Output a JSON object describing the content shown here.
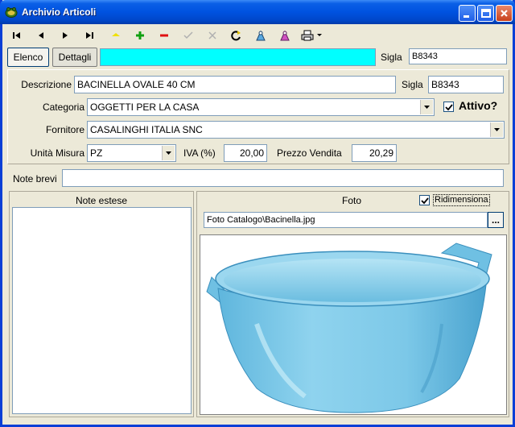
{
  "window": {
    "title": "Archivio Articoli",
    "icon": "frog-app-icon"
  },
  "toolbar": {
    "icons": [
      "first-record-icon",
      "prev-record-icon",
      "next-record-icon",
      "last-record-icon",
      "edit-icon",
      "add-icon",
      "delete-icon",
      "confirm-icon",
      "cancel-icon",
      "refresh-icon",
      "search-icon",
      "filter-icon",
      "print-icon"
    ]
  },
  "tabs": {
    "elenco": "Elenco",
    "dettagli": "Dettagli"
  },
  "header": {
    "sigla_label": "Sigla",
    "sigla_value": "B8343",
    "highlight_value": ""
  },
  "form": {
    "descrizione_label": "Descrizione",
    "descrizione_value": "BACINELLA OVALE 40 CM",
    "sigla_label": "Sigla",
    "sigla_value": "B8343",
    "categoria_label": "Categoria",
    "categoria_value": "OGGETTI PER LA CASA",
    "attivo_label": "Attivo?",
    "attivo_checked": true,
    "fornitore_label": "Fornitore",
    "fornitore_value": "CASALINGHI ITALIA SNC",
    "unita_label": "Unità Misura",
    "unita_value": "PZ",
    "iva_label": "IVA (%)",
    "iva_value": "20,00",
    "prezzo_label": "Prezzo Vendita",
    "prezzo_value": "20,29",
    "note_brevi_label": "Note brevi",
    "note_brevi_value": ""
  },
  "notes": {
    "title": "Note estese",
    "value": ""
  },
  "foto": {
    "title": "Foto",
    "ridimensiona_label": "Ridimensiona",
    "ridimensiona_checked": true,
    "path": "Foto Catalogo\\Bacinella.jpg",
    "browse_label": "..."
  },
  "colors": {
    "highlight": "#00ffff",
    "title_bar": "#0054e3",
    "basin": "#7cc8e8"
  }
}
